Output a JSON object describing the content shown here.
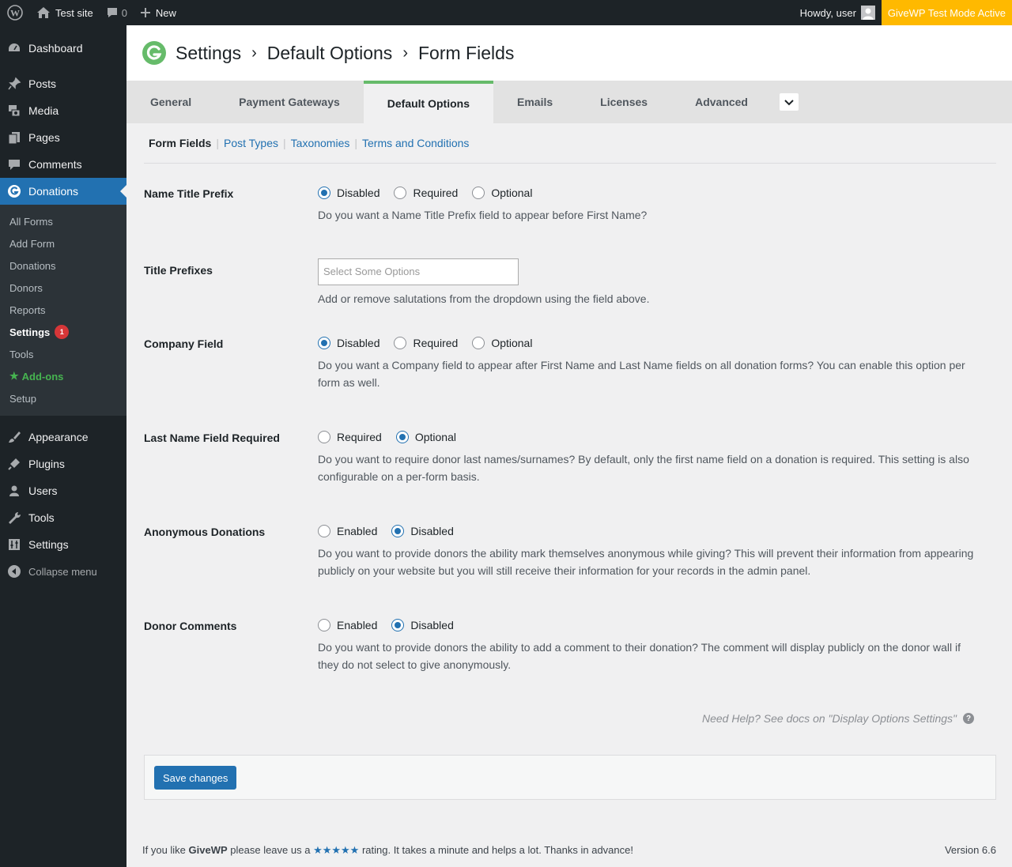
{
  "adminbar": {
    "site_name": "Test site",
    "comments_count": "0",
    "new_label": "New",
    "howdy": "Howdy, user",
    "test_mode": "GiveWP Test Mode Active"
  },
  "sidebar": {
    "items_top": [
      {
        "label": "Dashboard",
        "icon": "dashboard-icon"
      },
      {
        "label": "Posts",
        "icon": "pin-icon"
      },
      {
        "label": "Media",
        "icon": "media-icon"
      },
      {
        "label": "Pages",
        "icon": "pages-icon"
      },
      {
        "label": "Comments",
        "icon": "comments-icon"
      },
      {
        "label": "Donations",
        "icon": "givewp-icon"
      }
    ],
    "submenu": [
      {
        "label": "All Forms"
      },
      {
        "label": "Add Form"
      },
      {
        "label": "Donations"
      },
      {
        "label": "Donors"
      },
      {
        "label": "Reports"
      },
      {
        "label": "Settings",
        "badge": "1"
      },
      {
        "label": "Tools"
      },
      {
        "label": "Add-ons"
      },
      {
        "label": "Setup"
      }
    ],
    "items_bottom": [
      {
        "label": "Appearance",
        "icon": "brush-icon"
      },
      {
        "label": "Plugins",
        "icon": "plugin-icon"
      },
      {
        "label": "Users",
        "icon": "users-icon"
      },
      {
        "label": "Tools",
        "icon": "wrench-icon"
      },
      {
        "label": "Settings",
        "icon": "settings-icon"
      }
    ],
    "collapse": "Collapse menu"
  },
  "header": {
    "crumbs": [
      "Settings",
      "Default Options",
      "Form Fields"
    ],
    "separator": "›"
  },
  "tabs": [
    "General",
    "Payment Gateways",
    "Default Options",
    "Emails",
    "Licenses",
    "Advanced"
  ],
  "subnav": [
    "Form Fields",
    "Post Types",
    "Taxonomies",
    "Terms and Conditions"
  ],
  "fields": {
    "name_title_prefix": {
      "label": "Name Title Prefix",
      "options": [
        "Disabled",
        "Required",
        "Optional"
      ],
      "selected": "Disabled",
      "desc": "Do you want a Name Title Prefix field to appear before First Name?"
    },
    "title_prefixes": {
      "label": "Title Prefixes",
      "placeholder": "Select Some Options",
      "desc": "Add or remove salutations from the dropdown using the field above."
    },
    "company_field": {
      "label": "Company Field",
      "options": [
        "Disabled",
        "Required",
        "Optional"
      ],
      "selected": "Disabled",
      "desc": "Do you want a Company field to appear after First Name and Last Name fields on all donation forms? You can enable this option per form as well."
    },
    "last_name": {
      "label": "Last Name Field Required",
      "options": [
        "Required",
        "Optional"
      ],
      "selected": "Optional",
      "desc": "Do you want to require donor last names/surnames? By default, only the first name field on a donation is required. This setting is also configurable on a per-form basis."
    },
    "anonymous": {
      "label": "Anonymous Donations",
      "options": [
        "Enabled",
        "Disabled"
      ],
      "selected": "Disabled",
      "desc": "Do you want to provide donors the ability mark themselves anonymous while giving? This will prevent their information from appearing publicly on your website but you will still receive their information for your records in the admin panel."
    },
    "donor_comments": {
      "label": "Donor Comments",
      "options": [
        "Enabled",
        "Disabled"
      ],
      "selected": "Disabled",
      "desc": "Do you want to provide donors the ability to add a comment to their donation? The comment will display publicly on the donor wall if they do not select to give anonymously."
    }
  },
  "help_text": "Need Help? See docs on \"Display Options Settings\"",
  "save_label": "Save changes",
  "footer": {
    "before": "If you like ",
    "brand": "GiveWP",
    "middle": " please leave us a ",
    "stars": "★★★★★",
    "after": " rating. It takes a minute and helps a lot. Thanks in advance!",
    "version": "Version 6.6"
  },
  "colors": {
    "accent": "#2271b1",
    "active_tab_border": "#66bb6a",
    "test_mode_bg": "#ffb900",
    "sidebar_bg": "#1d2327"
  }
}
